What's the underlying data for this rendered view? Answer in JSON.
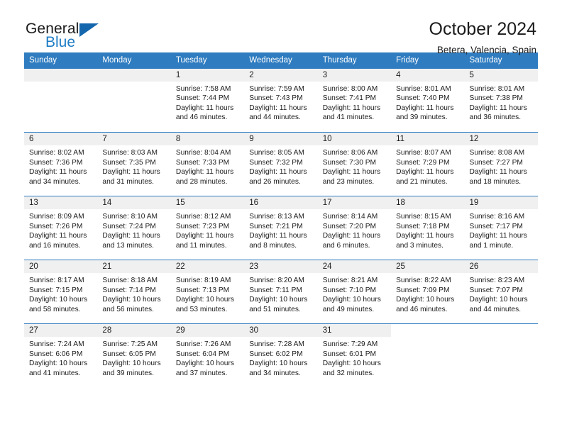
{
  "brand": {
    "name_part1": "General",
    "name_part2": "Blue",
    "triangle_color": "#1567ad",
    "blue_color": "#1d7cc4"
  },
  "header": {
    "title": "October 2024",
    "subtitle": "Betera, Valencia, Spain"
  },
  "theme": {
    "header_row_bg": "#2f7cc0",
    "date_band_bg": "#f0f0f0",
    "grid_line": "#2f7cc0",
    "text": "#1b1b1b"
  },
  "weekday_headers": [
    "Sunday",
    "Monday",
    "Tuesday",
    "Wednesday",
    "Thursday",
    "Friday",
    "Saturday"
  ],
  "labels": {
    "sunrise_prefix": "Sunrise: ",
    "sunset_prefix": "Sunset: ",
    "daylight_prefix": "Daylight: "
  },
  "weeks": [
    [
      {
        "day": "",
        "empty": true
      },
      {
        "day": "",
        "empty": true
      },
      {
        "day": "1",
        "sunrise": "Sunrise: 7:58 AM",
        "sunset": "Sunset: 7:44 PM",
        "daylight": "Daylight: 11 hours and 46 minutes."
      },
      {
        "day": "2",
        "sunrise": "Sunrise: 7:59 AM",
        "sunset": "Sunset: 7:43 PM",
        "daylight": "Daylight: 11 hours and 44 minutes."
      },
      {
        "day": "3",
        "sunrise": "Sunrise: 8:00 AM",
        "sunset": "Sunset: 7:41 PM",
        "daylight": "Daylight: 11 hours and 41 minutes."
      },
      {
        "day": "4",
        "sunrise": "Sunrise: 8:01 AM",
        "sunset": "Sunset: 7:40 PM",
        "daylight": "Daylight: 11 hours and 39 minutes."
      },
      {
        "day": "5",
        "sunrise": "Sunrise: 8:01 AM",
        "sunset": "Sunset: 7:38 PM",
        "daylight": "Daylight: 11 hours and 36 minutes."
      }
    ],
    [
      {
        "day": "6",
        "sunrise": "Sunrise: 8:02 AM",
        "sunset": "Sunset: 7:36 PM",
        "daylight": "Daylight: 11 hours and 34 minutes."
      },
      {
        "day": "7",
        "sunrise": "Sunrise: 8:03 AM",
        "sunset": "Sunset: 7:35 PM",
        "daylight": "Daylight: 11 hours and 31 minutes."
      },
      {
        "day": "8",
        "sunrise": "Sunrise: 8:04 AM",
        "sunset": "Sunset: 7:33 PM",
        "daylight": "Daylight: 11 hours and 28 minutes."
      },
      {
        "day": "9",
        "sunrise": "Sunrise: 8:05 AM",
        "sunset": "Sunset: 7:32 PM",
        "daylight": "Daylight: 11 hours and 26 minutes."
      },
      {
        "day": "10",
        "sunrise": "Sunrise: 8:06 AM",
        "sunset": "Sunset: 7:30 PM",
        "daylight": "Daylight: 11 hours and 23 minutes."
      },
      {
        "day": "11",
        "sunrise": "Sunrise: 8:07 AM",
        "sunset": "Sunset: 7:29 PM",
        "daylight": "Daylight: 11 hours and 21 minutes."
      },
      {
        "day": "12",
        "sunrise": "Sunrise: 8:08 AM",
        "sunset": "Sunset: 7:27 PM",
        "daylight": "Daylight: 11 hours and 18 minutes."
      }
    ],
    [
      {
        "day": "13",
        "sunrise": "Sunrise: 8:09 AM",
        "sunset": "Sunset: 7:26 PM",
        "daylight": "Daylight: 11 hours and 16 minutes."
      },
      {
        "day": "14",
        "sunrise": "Sunrise: 8:10 AM",
        "sunset": "Sunset: 7:24 PM",
        "daylight": "Daylight: 11 hours and 13 minutes."
      },
      {
        "day": "15",
        "sunrise": "Sunrise: 8:12 AM",
        "sunset": "Sunset: 7:23 PM",
        "daylight": "Daylight: 11 hours and 11 minutes."
      },
      {
        "day": "16",
        "sunrise": "Sunrise: 8:13 AM",
        "sunset": "Sunset: 7:21 PM",
        "daylight": "Daylight: 11 hours and 8 minutes."
      },
      {
        "day": "17",
        "sunrise": "Sunrise: 8:14 AM",
        "sunset": "Sunset: 7:20 PM",
        "daylight": "Daylight: 11 hours and 6 minutes."
      },
      {
        "day": "18",
        "sunrise": "Sunrise: 8:15 AM",
        "sunset": "Sunset: 7:18 PM",
        "daylight": "Daylight: 11 hours and 3 minutes."
      },
      {
        "day": "19",
        "sunrise": "Sunrise: 8:16 AM",
        "sunset": "Sunset: 7:17 PM",
        "daylight": "Daylight: 11 hours and 1 minute."
      }
    ],
    [
      {
        "day": "20",
        "sunrise": "Sunrise: 8:17 AM",
        "sunset": "Sunset: 7:15 PM",
        "daylight": "Daylight: 10 hours and 58 minutes."
      },
      {
        "day": "21",
        "sunrise": "Sunrise: 8:18 AM",
        "sunset": "Sunset: 7:14 PM",
        "daylight": "Daylight: 10 hours and 56 minutes."
      },
      {
        "day": "22",
        "sunrise": "Sunrise: 8:19 AM",
        "sunset": "Sunset: 7:13 PM",
        "daylight": "Daylight: 10 hours and 53 minutes."
      },
      {
        "day": "23",
        "sunrise": "Sunrise: 8:20 AM",
        "sunset": "Sunset: 7:11 PM",
        "daylight": "Daylight: 10 hours and 51 minutes."
      },
      {
        "day": "24",
        "sunrise": "Sunrise: 8:21 AM",
        "sunset": "Sunset: 7:10 PM",
        "daylight": "Daylight: 10 hours and 49 minutes."
      },
      {
        "day": "25",
        "sunrise": "Sunrise: 8:22 AM",
        "sunset": "Sunset: 7:09 PM",
        "daylight": "Daylight: 10 hours and 46 minutes."
      },
      {
        "day": "26",
        "sunrise": "Sunrise: 8:23 AM",
        "sunset": "Sunset: 7:07 PM",
        "daylight": "Daylight: 10 hours and 44 minutes."
      }
    ],
    [
      {
        "day": "27",
        "sunrise": "Sunrise: 7:24 AM",
        "sunset": "Sunset: 6:06 PM",
        "daylight": "Daylight: 10 hours and 41 minutes."
      },
      {
        "day": "28",
        "sunrise": "Sunrise: 7:25 AM",
        "sunset": "Sunset: 6:05 PM",
        "daylight": "Daylight: 10 hours and 39 minutes."
      },
      {
        "day": "29",
        "sunrise": "Sunrise: 7:26 AM",
        "sunset": "Sunset: 6:04 PM",
        "daylight": "Daylight: 10 hours and 37 minutes."
      },
      {
        "day": "30",
        "sunrise": "Sunrise: 7:28 AM",
        "sunset": "Sunset: 6:02 PM",
        "daylight": "Daylight: 10 hours and 34 minutes."
      },
      {
        "day": "31",
        "sunrise": "Sunrise: 7:29 AM",
        "sunset": "Sunset: 6:01 PM",
        "daylight": "Daylight: 10 hours and 32 minutes."
      },
      {
        "day": "",
        "empty": true,
        "void": true
      },
      {
        "day": "",
        "empty": true,
        "void": true
      }
    ]
  ]
}
